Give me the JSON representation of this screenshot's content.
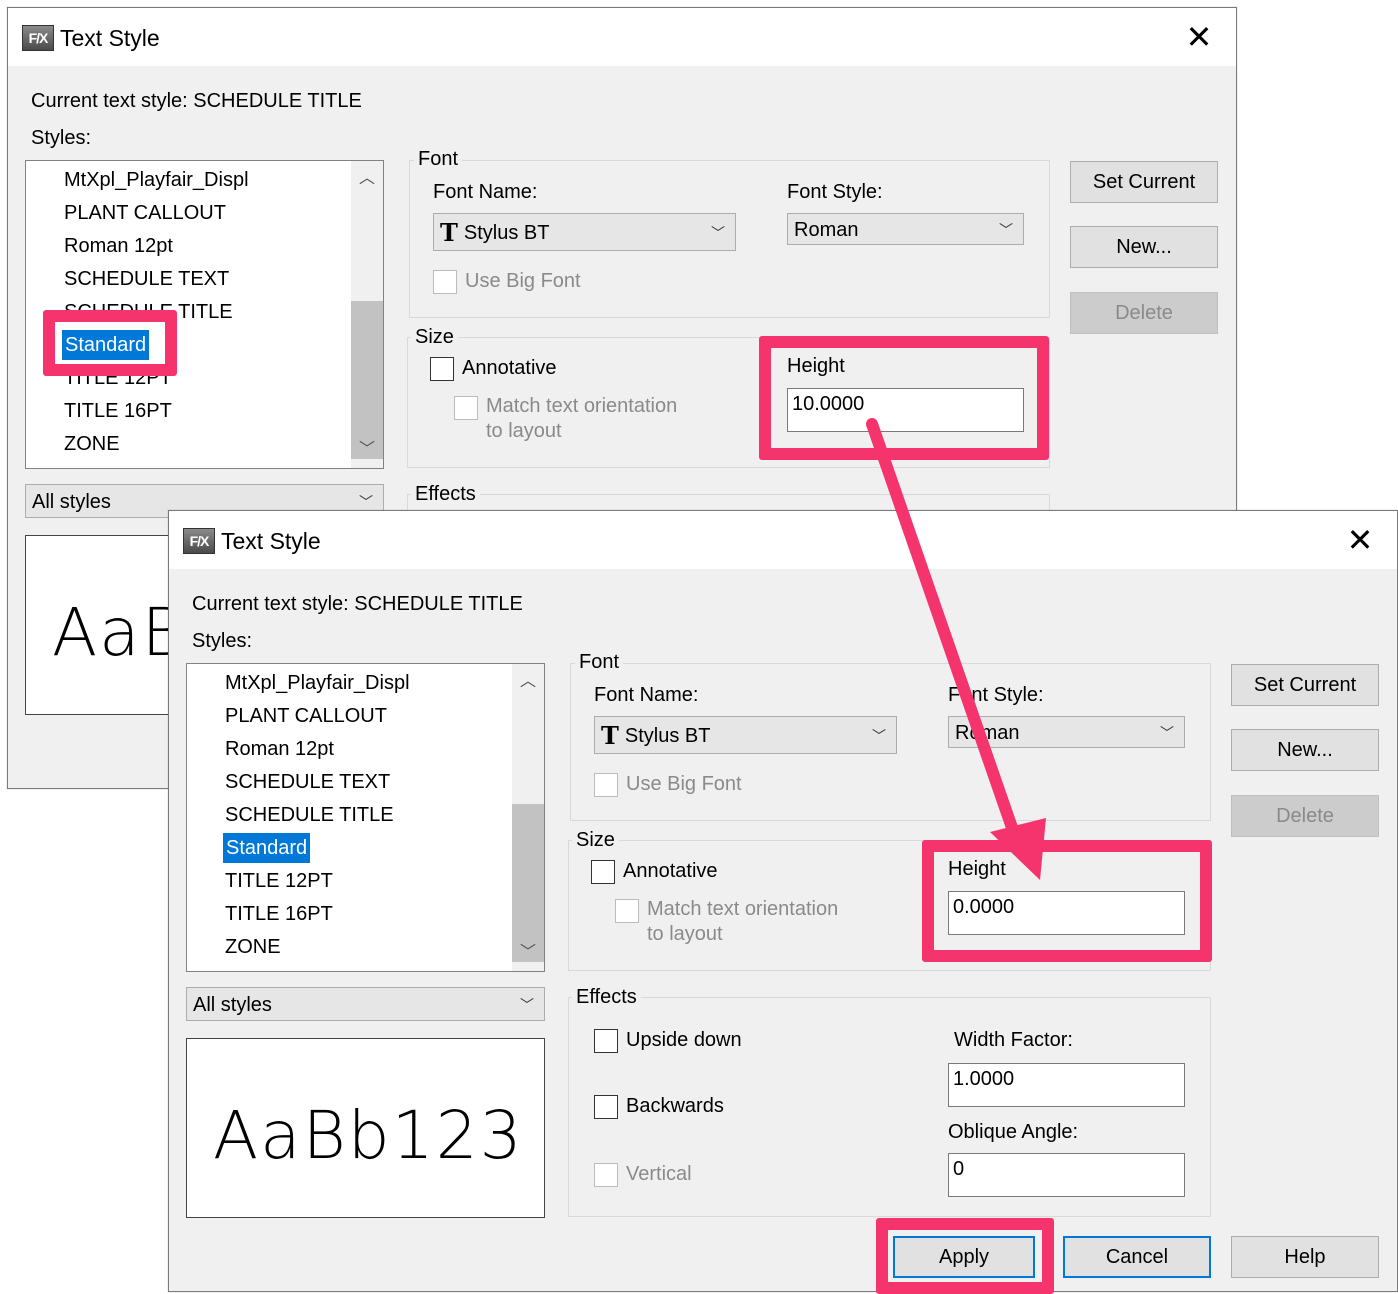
{
  "dialog": {
    "title": "Text Style",
    "app_icon_text": "F/X",
    "close_symbol": "✕",
    "current_style_label": "Current text style: SCHEDULE TITLE",
    "styles_label": "Styles:",
    "styles": [
      "MtXpl_Playfair_Displ",
      "PLANT CALLOUT",
      "Roman 12pt",
      "SCHEDULE TEXT",
      "SCHEDULE TITLE",
      "Standard",
      "TITLE 12PT",
      "TITLE 16PT",
      "ZONE"
    ],
    "selected_style": "Standard",
    "filter_value": "All styles",
    "preview_text": "AaBb123",
    "font_group": "Font",
    "font_name_label": "Font Name:",
    "font_name_value": "Stylus BT",
    "font_style_label": "Font Style:",
    "font_style_value": "Roman",
    "use_big_font_label": "Use Big Font",
    "size_group": "Size",
    "annotative_label": "Annotative",
    "match_orientation_label_1": "Match text orientation",
    "match_orientation_label_2": "to layout",
    "height_label": "Height",
    "effects_group": "Effects",
    "upside_down_label": "Upside down",
    "backwards_label": "Backwards",
    "vertical_label": "Vertical",
    "width_factor_label": "Width Factor:",
    "width_factor_value": "1.0000",
    "oblique_angle_label": "Oblique Angle:",
    "oblique_angle_value": "0",
    "buttons": {
      "set_current": "Set Current",
      "new": "New...",
      "delete": "Delete",
      "apply": "Apply",
      "cancel": "Cancel",
      "help": "Help"
    }
  },
  "back_dialog": {
    "height_value": "10.0000"
  },
  "front_dialog": {
    "height_value": "0.0000"
  },
  "colors": {
    "highlight": "#f5336c",
    "selection": "#0078d7"
  }
}
